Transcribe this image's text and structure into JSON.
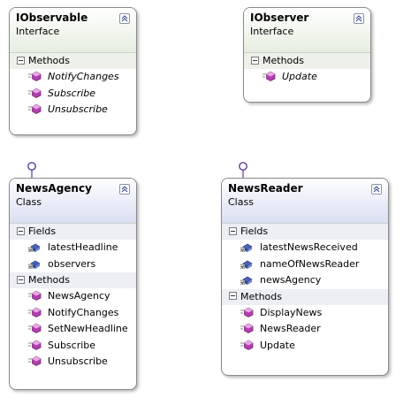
{
  "classes": [
    {
      "name": "IObservable",
      "stereotype": "Interface",
      "sections": [
        {
          "title": "Methods",
          "kind": "method",
          "italic": true,
          "items": [
            "NotifyChanges",
            "Subscribe",
            "Unsubscribe"
          ]
        }
      ]
    },
    {
      "name": "IObserver",
      "stereotype": "Interface",
      "sections": [
        {
          "title": "Methods",
          "kind": "method",
          "italic": true,
          "items": [
            "Update"
          ]
        }
      ]
    },
    {
      "name": "NewsAgency",
      "stereotype": "Class",
      "sections": [
        {
          "title": "Fields",
          "kind": "field",
          "italic": false,
          "items": [
            "latestHeadline",
            "observers"
          ]
        },
        {
          "title": "Methods",
          "kind": "method",
          "italic": false,
          "items": [
            "NewsAgency",
            "NotifyChanges",
            "SetNewHeadline",
            "Subscribe",
            "Unsubscribe"
          ]
        }
      ]
    },
    {
      "name": "NewsReader",
      "stereotype": "Class",
      "sections": [
        {
          "title": "Fields",
          "kind": "field",
          "italic": false,
          "items": [
            "latestNewsReceived",
            "nameOfNewsReader",
            "newsAgency"
          ]
        },
        {
          "title": "Methods",
          "kind": "method",
          "italic": false,
          "items": [
            "DisplayNews",
            "NewsReader",
            "Update"
          ]
        }
      ]
    }
  ],
  "colors": {
    "interface_header": "#e6eee0",
    "class_header": "#dadff2",
    "method_icon": "#b23fb0",
    "field_icon": "#4a63b8",
    "lollipop": "#5a3d9e"
  }
}
